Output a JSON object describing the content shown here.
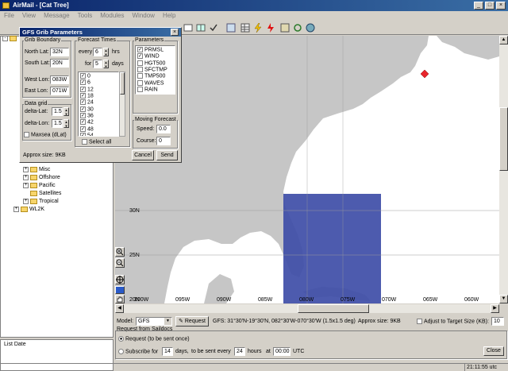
{
  "app": {
    "title": "AirMail - [Cat Tree]",
    "menu": [
      "File",
      "View",
      "Message",
      "Tools",
      "Modules",
      "Window",
      "Help"
    ]
  },
  "tree": [
    {
      "label": "Misc",
      "pm": "+"
    },
    {
      "label": "Offshore",
      "pm": "+"
    },
    {
      "label": "Pacific",
      "pm": "+"
    },
    {
      "label": "Satellites",
      "pm": ""
    },
    {
      "label": "Tropical",
      "pm": "+"
    },
    {
      "label": "WL2K",
      "pm": "+"
    }
  ],
  "list_header": "List Date",
  "map": {
    "lat_labels": [
      "30N",
      "25N",
      "20N"
    ],
    "lon_labels": [
      "100W",
      "095W",
      "090W",
      "085W",
      "080W",
      "075W",
      "070W",
      "065W",
      "060W"
    ],
    "colors": {
      "land": "#c6c6c6",
      "sea": "#ffffff",
      "grib_box": "#3f4fa8",
      "marker": "#e8242c"
    }
  },
  "bottom": {
    "model_label": "Model:",
    "model_value": "GFS",
    "request_button": "Request",
    "summary": "GFS: 31°30'N-19°30'N, 082°30'W-070°30'W (1.5x1.5 deg)",
    "approx": "Approx size: 9KB",
    "adjust_label": "Adjust to Target Size (KB):",
    "adjust_value": "10",
    "group_title": "Request from Saildocs",
    "radio1": "Request (to be sent once)",
    "radio2": "Subscribe for",
    "days_value": "14",
    "days_label": "days,",
    "every_label": "to be sent every",
    "hours_value": "24",
    "hours_label": "hours",
    "at_label": "at",
    "time_value": "00:00",
    "utc": "UTC",
    "close_button": "Close"
  },
  "status": {
    "time": "21:11:55 utc"
  },
  "dialog": {
    "title": "GFS Grib Parameters",
    "close": "×",
    "grib_boundary": {
      "title": "Grib Boundary",
      "north_label": "North Lat:",
      "north": "32N",
      "south_label": "South Lat:",
      "south": "20N",
      "west_label": "West Lon:",
      "west": "083W",
      "east_label": "East Lon:",
      "east": "071W"
    },
    "data_grid": {
      "title": "Data grid",
      "dlat_label": "delta-Lat:",
      "dlat": "1.5",
      "dlon_label": "delta-Lon:",
      "dlon": "1.5",
      "maxsea": "Maxsea (dLat)"
    },
    "forecast": {
      "title": "Forecast Times",
      "every_label": "every",
      "every_value": "6",
      "hrs": "hrs",
      "for_label": "for",
      "for_value": "5",
      "days": "days",
      "times": [
        "0",
        "6",
        "12",
        "18",
        "24",
        "30",
        "36",
        "42",
        "48",
        "54"
      ],
      "select_all": "Select all"
    },
    "parameters": {
      "title": "Parameters",
      "items": [
        {
          "name": "PRMSL",
          "checked": true
        },
        {
          "name": "WIND",
          "checked": true
        },
        {
          "name": "HGT500",
          "checked": false
        },
        {
          "name": "SFCTMP",
          "checked": false
        },
        {
          "name": "TMP500",
          "checked": false
        },
        {
          "name": "WAVES",
          "checked": false
        },
        {
          "name": "RAIN",
          "checked": false
        }
      ]
    },
    "moving": {
      "title": "Moving Forecast",
      "speed_label": "Speed:",
      "speed": "0.0",
      "course_label": "Course:",
      "course": "0"
    },
    "approx": "Approx size: 9KB",
    "cancel": "Cancel",
    "send": "Send"
  }
}
